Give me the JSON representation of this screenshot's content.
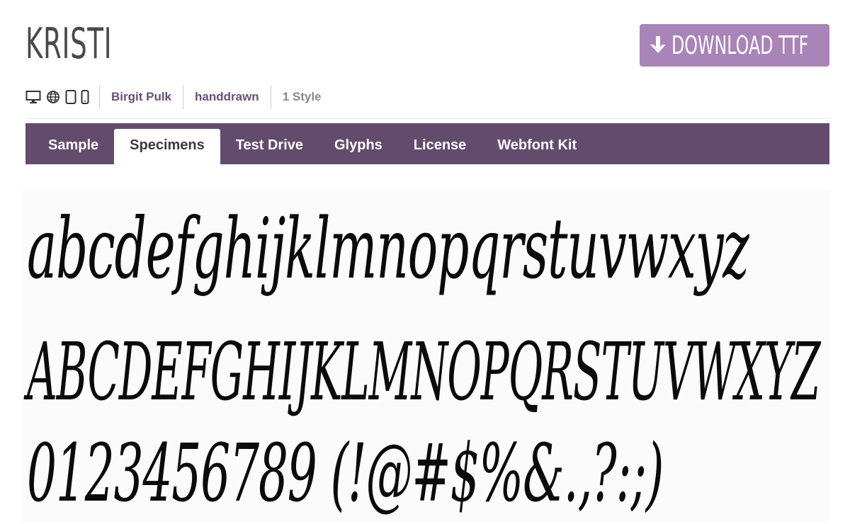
{
  "header": {
    "title": "KRISTI",
    "download_label": "DOWNLOAD TTF",
    "download_color": "#a884b8"
  },
  "meta": {
    "icons": [
      "desktop-icon",
      "globe-icon",
      "tablet-icon",
      "phone-icon"
    ],
    "designer": "Birgit Pulk",
    "category": "handdrawn",
    "styles": "1 Style"
  },
  "tabs": [
    {
      "label": "Sample"
    },
    {
      "label": "Specimens",
      "active": true
    },
    {
      "label": "Test Drive"
    },
    {
      "label": "Glyphs"
    },
    {
      "label": "License"
    },
    {
      "label": "Webfont Kit"
    }
  ],
  "tab_bar_color": "#634b6d",
  "specimen": {
    "lowercase": "abcdefghijklmnopqrstuvwxyz",
    "uppercase": "ABCDEFGHIJKLMNOPQRSTUVWXYZ",
    "numbers_symbols": "0123456789 (!@#$%&.,?:;)"
  }
}
